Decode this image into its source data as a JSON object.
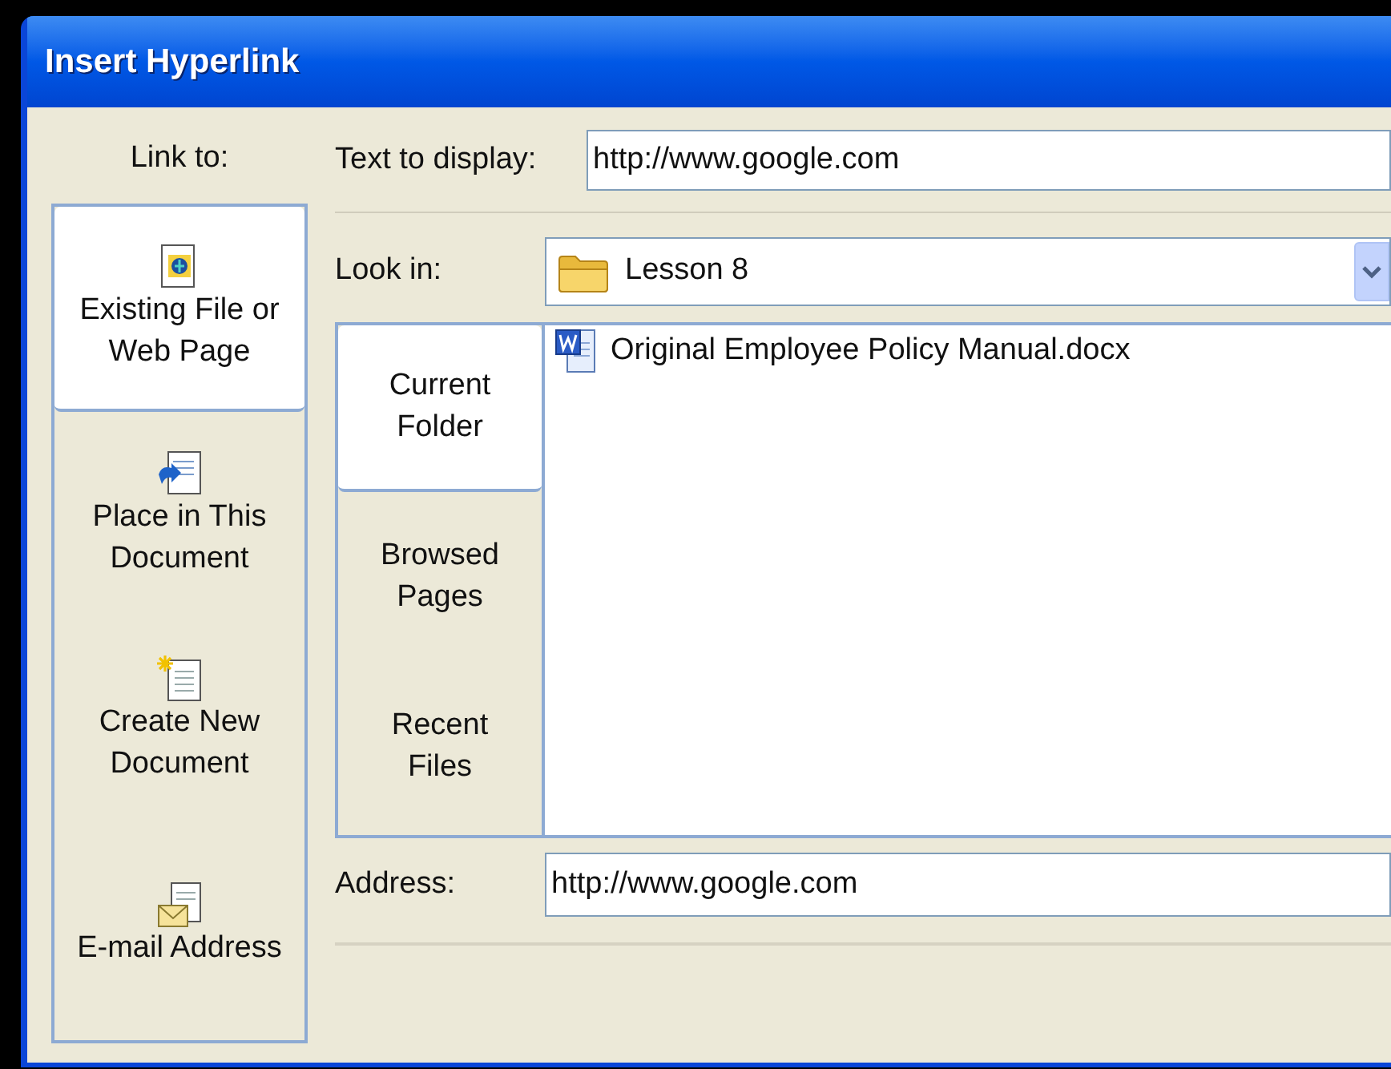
{
  "window": {
    "title": "Insert Hyperlink"
  },
  "link_to": {
    "label": "Link to:",
    "items": [
      {
        "kind": "file",
        "label": "Existing File or Web Page",
        "selected": true
      },
      {
        "kind": "place",
        "label": "Place in This Document",
        "selected": false
      },
      {
        "kind": "new",
        "label": "Create New Document",
        "selected": false
      },
      {
        "kind": "email",
        "label": "E-mail Address",
        "selected": false
      }
    ]
  },
  "text_to_display": {
    "label": "Text to display:",
    "value": "http://www.google.com"
  },
  "look_in": {
    "label": "Look in:",
    "value": "Lesson 8"
  },
  "browse_tabs": [
    {
      "label": "Current Folder",
      "selected": true
    },
    {
      "label": "Browsed Pages",
      "selected": false
    },
    {
      "label": "Recent Files",
      "selected": false
    }
  ],
  "files": [
    {
      "name": "Original Employee Policy Manual.docx"
    }
  ],
  "address": {
    "label": "Address:",
    "value": "http://www.google.com"
  }
}
